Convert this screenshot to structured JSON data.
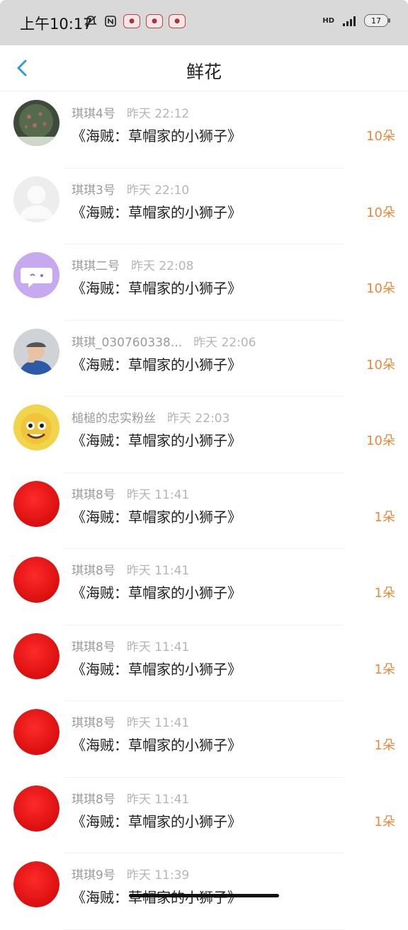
{
  "status_bar": {
    "time": "上午10:17",
    "hd": "HD",
    "battery": "17"
  },
  "header": {
    "title": "鲜花"
  },
  "items": [
    {
      "name": "琪琪4号",
      "time": "昨天 22:12",
      "work": "《海贼：草帽家的小狮子》",
      "count": "10朵",
      "avatar": "tree-photo"
    },
    {
      "name": "琪琪3号",
      "time": "昨天 22:10",
      "work": "《海贼：草帽家的小狮子》",
      "count": "10朵",
      "avatar": "default-user"
    },
    {
      "name": "琪琪二号",
      "time": "昨天 22:08",
      "work": "《海贼：草帽家的小狮子》",
      "count": "10朵",
      "avatar": "chat-bubble"
    },
    {
      "name": "琪琪_030760338...",
      "time": "昨天 22:06",
      "work": "《海贼：草帽家的小狮子》",
      "count": "10朵",
      "avatar": "child-photo"
    },
    {
      "name": "槌槌的忠实粉丝",
      "time": "昨天 22:03",
      "work": "《海贼：草帽家的小狮子》",
      "count": "10朵",
      "avatar": "sun-face"
    },
    {
      "name": "琪琪8号",
      "time": "昨天 11:41",
      "work": "《海贼：草帽家的小狮子》",
      "count": "1朵",
      "avatar": "red-circle"
    },
    {
      "name": "琪琪8号",
      "time": "昨天 11:41",
      "work": "《海贼：草帽家的小狮子》",
      "count": "1朵",
      "avatar": "red-circle"
    },
    {
      "name": "琪琪8号",
      "time": "昨天 11:41",
      "work": "《海贼：草帽家的小狮子》",
      "count": "1朵",
      "avatar": "red-circle"
    },
    {
      "name": "琪琪8号",
      "time": "昨天 11:41",
      "work": "《海贼：草帽家的小狮子》",
      "count": "1朵",
      "avatar": "red-circle"
    },
    {
      "name": "琪琪8号",
      "time": "昨天 11:41",
      "work": "《海贼：草帽家的小狮子》",
      "count": "1朵",
      "avatar": "red-circle"
    },
    {
      "name": "琪琪9号",
      "time": "昨天 11:39",
      "work": "《海贼：草帽家的小狮子》",
      "count": "",
      "avatar": "red-circle"
    }
  ],
  "colors": {
    "accent_blue": "#2f9bd8",
    "count_orange": "#e9883a",
    "statusbar_bg": "#d9d9d9"
  }
}
